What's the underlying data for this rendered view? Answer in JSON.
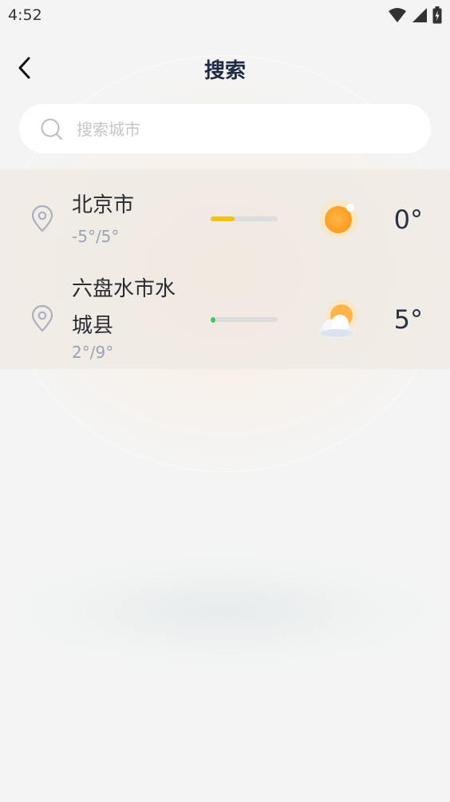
{
  "status": {
    "time": "4:52"
  },
  "header": {
    "title": "搜索"
  },
  "search": {
    "placeholder": "搜索城市",
    "value": ""
  },
  "cities": [
    {
      "name": "北京市",
      "range": "-5°/5°",
      "temp": "0°",
      "weather_icon": "sunny-icon",
      "aqi_fraction": 0.36,
      "aqi_color": "#f2c21a"
    },
    {
      "name_line1": "六盘水市水",
      "name_line2": "城县",
      "range": "2°/9°",
      "temp": "5°",
      "weather_icon": "partly-cloudy-icon",
      "aqi_fraction": 0.08,
      "aqi_color": "#4cc464"
    }
  ]
}
